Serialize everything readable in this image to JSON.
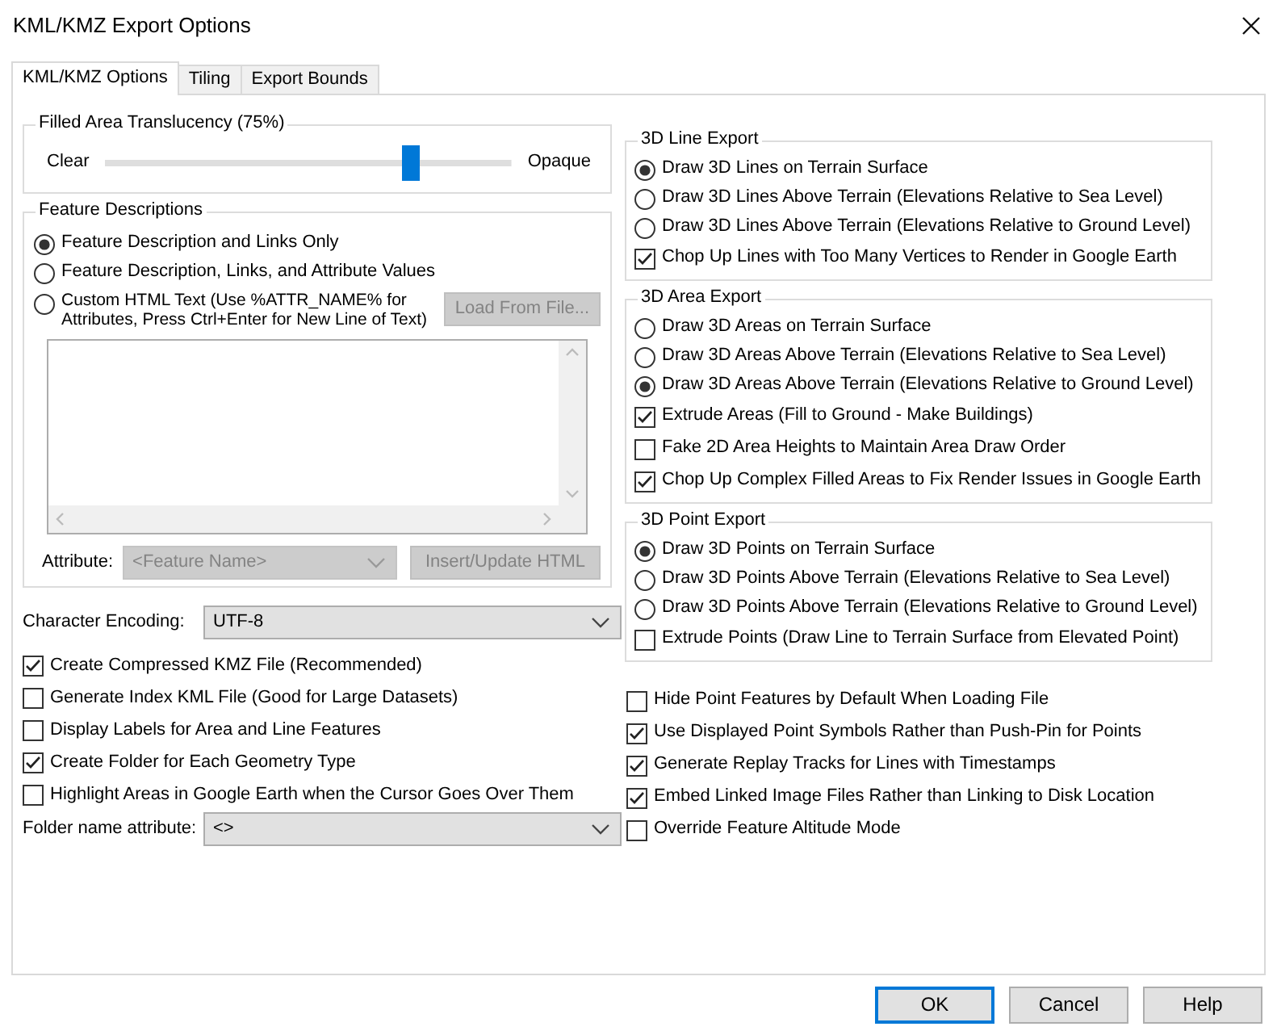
{
  "window": {
    "title": "KML/KMZ Export Options"
  },
  "tabs": [
    {
      "label": "KML/KMZ Options",
      "selected": true
    },
    {
      "label": "Tiling",
      "selected": false
    },
    {
      "label": "Export Bounds",
      "selected": false
    }
  ],
  "translucency": {
    "title": "Filled Area Translucency (75%)",
    "left_label": "Clear",
    "right_label": "Opaque",
    "level": 0.75
  },
  "feature_descriptions": {
    "title": "Feature Descriptions",
    "options": [
      {
        "label": "Feature Description and Links Only",
        "selected": true
      },
      {
        "label": "Feature Description, Links, and Attribute Values",
        "selected": false
      },
      {
        "label": "Custom HTML Text (Use %ATTR_NAME% for Attributes, Press Ctrl+Enter for New Line of Text)",
        "selected": false
      }
    ],
    "load_button": {
      "label": "Load From File...",
      "disabled": true
    },
    "attribute": {
      "label": "Attribute:",
      "value": "<Feature Name>",
      "disabled": true
    },
    "insert_button": {
      "label": "Insert/Update HTML",
      "disabled": true
    }
  },
  "character_encoding": {
    "label": "Character Encoding:",
    "value": "UTF-8"
  },
  "left_checkboxes": [
    {
      "label": "Create Compressed KMZ File (Recommended)",
      "checked": true
    },
    {
      "label": "Generate Index KML File (Good for Large Datasets)",
      "checked": false
    },
    {
      "label": "Display Labels for Area and Line Features",
      "checked": false
    },
    {
      "label": "Create Folder for Each Geometry Type",
      "checked": true
    },
    {
      "label": "Highlight Areas in Google Earth when the Cursor Goes Over Them",
      "checked": false
    }
  ],
  "folder_name_attribute": {
    "label": "Folder name attribute:",
    "value": "<>"
  },
  "export_groups": [
    {
      "title": "3D Line Export",
      "options": [
        {
          "label": "Draw 3D Lines on Terrain Surface",
          "selected": true
        },
        {
          "label": "Draw 3D Lines Above Terrain (Elevations Relative to Sea Level)",
          "selected": false
        },
        {
          "label": "Draw 3D Lines Above Terrain (Elevations Relative to Ground Level)",
          "selected": false
        }
      ],
      "checkboxes": [
        {
          "label": "Chop Up Lines with Too Many Vertices to Render in Google Earth",
          "checked": true
        }
      ]
    },
    {
      "title": "3D Area Export",
      "options": [
        {
          "label": "Draw 3D Areas on Terrain Surface",
          "selected": false
        },
        {
          "label": "Draw 3D Areas Above Terrain (Elevations Relative to Sea Level)",
          "selected": false
        },
        {
          "label": "Draw 3D Areas Above Terrain (Elevations Relative to Ground Level)",
          "selected": true
        }
      ],
      "checkboxes": [
        {
          "label": "Extrude Areas (Fill to Ground - Make Buildings)",
          "checked": true
        },
        {
          "label": "Fake 2D Area Heights to Maintain Area Draw Order",
          "checked": false
        },
        {
          "label": "Chop Up Complex Filled Areas to Fix Render Issues in Google Earth",
          "checked": true
        }
      ]
    },
    {
      "title": "3D Point Export",
      "options": [
        {
          "label": "Draw 3D Points on Terrain Surface",
          "selected": true
        },
        {
          "label": "Draw 3D Points Above Terrain (Elevations Relative to Sea Level)",
          "selected": false
        },
        {
          "label": "Draw 3D Points Above Terrain (Elevations Relative to Ground Level)",
          "selected": false
        }
      ],
      "checkboxes": [
        {
          "label": "Extrude Points (Draw Line to Terrain Surface from Elevated Point)",
          "checked": false
        }
      ]
    }
  ],
  "right_checkboxes": [
    {
      "label": "Hide Point Features by Default When Loading File",
      "checked": false
    },
    {
      "label": "Use Displayed Point Symbols Rather than Push-Pin for Points",
      "checked": true
    },
    {
      "label": "Generate Replay Tracks for Lines with Timestamps",
      "checked": true
    },
    {
      "label": "Embed Linked Image Files Rather than Linking to Disk Location",
      "checked": true
    },
    {
      "label": "Override Feature Altitude Mode",
      "checked": false
    }
  ],
  "buttons": [
    {
      "label": "OK",
      "default": true
    },
    {
      "label": "Cancel",
      "default": false
    },
    {
      "label": "Help",
      "default": false
    }
  ]
}
